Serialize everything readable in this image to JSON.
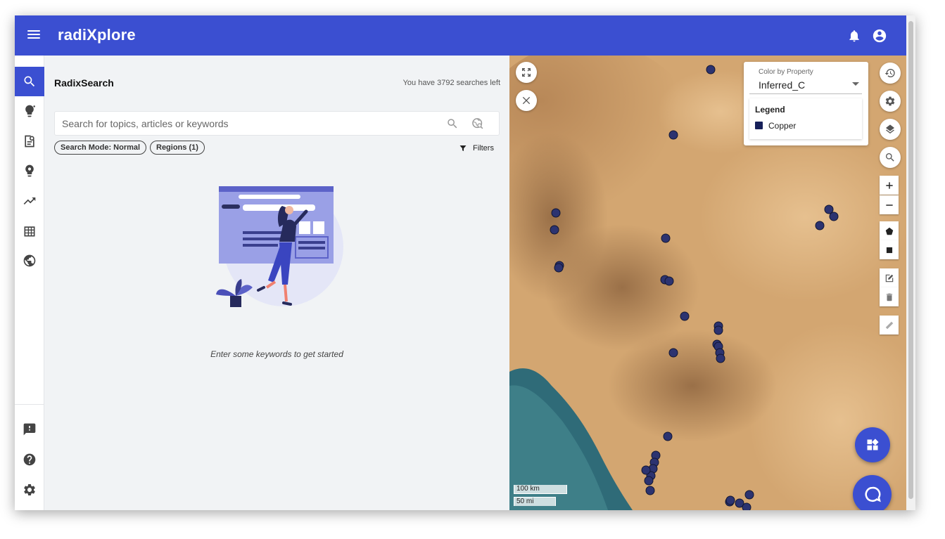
{
  "app": {
    "brand": "radiXplore"
  },
  "sidebar": {
    "items": [
      {
        "name": "search",
        "icon": "search-icon"
      },
      {
        "name": "insights",
        "icon": "lightbulb-icon"
      },
      {
        "name": "documents",
        "icon": "document-search-icon"
      },
      {
        "name": "ideas",
        "icon": "brain-bulb-icon"
      },
      {
        "name": "trends",
        "icon": "trending-up-icon"
      },
      {
        "name": "tables",
        "icon": "table-icon"
      },
      {
        "name": "globe",
        "icon": "globe-icon"
      }
    ],
    "bottom": [
      {
        "name": "feedback",
        "icon": "feedback-icon"
      },
      {
        "name": "help",
        "icon": "help-icon"
      },
      {
        "name": "settings",
        "icon": "gear-icon"
      }
    ]
  },
  "panel": {
    "title": "RadixSearch",
    "searches_left": "You have 3792 searches left",
    "search_placeholder": "Search for topics, articles or keywords",
    "chips": {
      "mode": "Search Mode: Normal",
      "regions": "Regions (1)"
    },
    "filters_label": "Filters",
    "empty_text": "Enter some keywords to get started"
  },
  "map": {
    "color_by": {
      "label": "Color by Property",
      "value": "Inferred_C"
    },
    "legend": {
      "title": "Legend",
      "items": [
        {
          "label": "Copper",
          "color": "#17205a"
        }
      ]
    },
    "scale": {
      "km": "100 km",
      "mi": "50 mi"
    },
    "marker_color": "#2c3370"
  },
  "colors": {
    "accent": "#3b4fd1",
    "panel_bg": "#f1f3f5"
  }
}
